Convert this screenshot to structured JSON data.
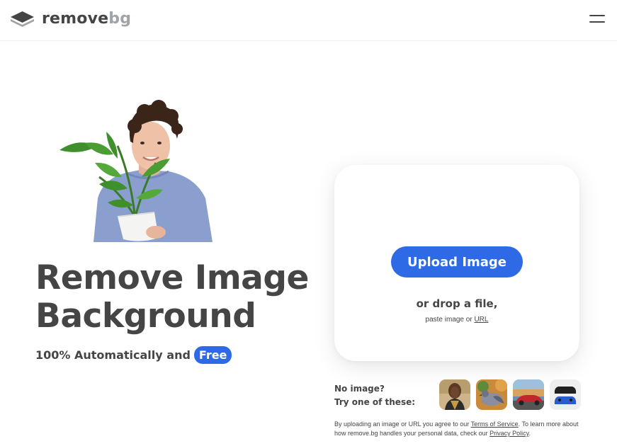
{
  "header": {
    "logo_remove": "remove",
    "logo_bg": "bg",
    "menu_icon": "hamburger-menu-icon"
  },
  "hero": {
    "title_line1": "Remove Image",
    "title_line2": "Background",
    "subtitle": "100% Automatically and",
    "badge": "Free"
  },
  "upload": {
    "button_label": "Upload Image",
    "drop_text": "or drop a file,",
    "paste_prefix": "paste image or",
    "url_link": "URL"
  },
  "samples": {
    "line1": "No image?",
    "line2": "Try one of these:",
    "items": [
      "woman-portrait-thumbnail",
      "pigeon-thumbnail",
      "red-car-thumbnail",
      "game-controllers-thumbnail"
    ]
  },
  "legal": {
    "part1": "By uploading an image or URL you agree to our",
    "terms_link": "Terms of Service",
    "part2": ". To learn more about how remove.bg handles your personal data, check our",
    "privacy_link": "Privacy Policy",
    "part3": "."
  },
  "colors": {
    "accent": "#2e6ae6",
    "text": "#454545",
    "logo_grey": "#a0a4a8"
  }
}
